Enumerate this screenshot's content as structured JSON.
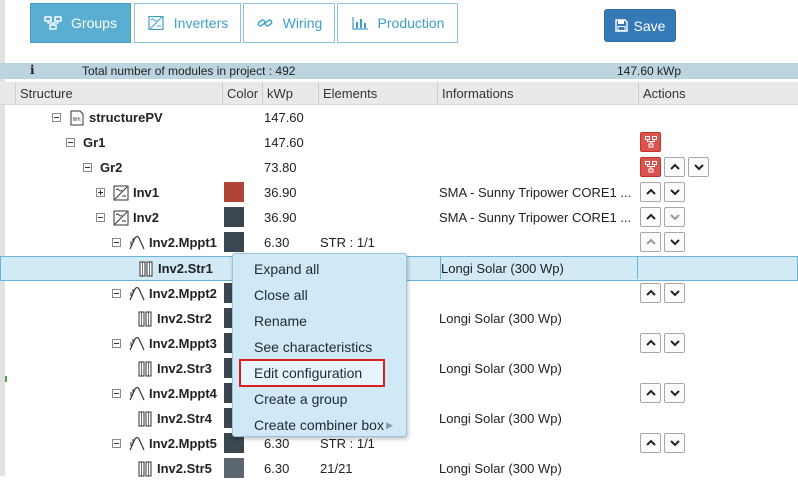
{
  "toolbar": {
    "tabs": [
      {
        "label": "Groups",
        "icon": "groups-icon",
        "active": true
      },
      {
        "label": "Inverters",
        "icon": "inverter-icon",
        "active": false
      },
      {
        "label": "Wiring",
        "icon": "link-icon",
        "active": false
      },
      {
        "label": "Production",
        "icon": "bar-chart-icon",
        "active": false
      }
    ],
    "save_label": "Save"
  },
  "infobar": {
    "icon": "info-icon",
    "icon_glyph": "i",
    "message": "Total number of modules in project : 492",
    "total": "147.60 kWp"
  },
  "columns": [
    "Structure",
    "Color",
    "kWp",
    "Elements",
    "Informations",
    "Actions"
  ],
  "colors": {
    "accent": "#5aaed1",
    "save": "#337ab7",
    "red_swatch": "#b04437",
    "dark_swatch": "#3b4650",
    "action_red": "#d9534f",
    "selection": "#d2e9f6",
    "highlight_border": "#d9201e"
  },
  "rows": [
    {
      "label": "structurePV",
      "kwp": "147.60",
      "elements": "",
      "info": ""
    },
    {
      "label": "Gr1",
      "kwp": "147.60",
      "elements": "",
      "info": ""
    },
    {
      "label": "Gr2",
      "kwp": "73.80",
      "elements": "",
      "info": ""
    },
    {
      "label": "Inv1",
      "kwp": "36.90",
      "elements": "",
      "info": "SMA - Sunny Tripower CORE1 ..."
    },
    {
      "label": "Inv2",
      "kwp": "36.90",
      "elements": "",
      "info": "SMA - Sunny Tripower CORE1 ..."
    },
    {
      "label": "Inv2.Mppt1",
      "kwp": "6.30",
      "elements": "STR : 1/1",
      "info": ""
    },
    {
      "label": "Inv2.Str1",
      "kwp": "",
      "elements": "",
      "info": "Longi Solar (300 Wp)"
    },
    {
      "label": "Inv2.Mppt2",
      "kwp": "",
      "elements": "",
      "info": ""
    },
    {
      "label": "Inv2.Str2",
      "kwp": "",
      "elements": "",
      "info": "Longi Solar (300 Wp)"
    },
    {
      "label": "Inv2.Mppt3",
      "kwp": "",
      "elements": "",
      "info": ""
    },
    {
      "label": "Inv2.Str3",
      "kwp": "",
      "elements": "",
      "info": "Longi Solar (300 Wp)"
    },
    {
      "label": "Inv2.Mppt4",
      "kwp": "",
      "elements": "",
      "info": ""
    },
    {
      "label": "Inv2.Str4",
      "kwp": "",
      "elements": "",
      "info": "Longi Solar (300 Wp)"
    },
    {
      "label": "Inv2.Mppt5",
      "kwp": "6.30",
      "elements": "STR : 1/1",
      "info": ""
    },
    {
      "label": "Inv2.Str5",
      "kwp": "6.30",
      "elements": "21/21",
      "info": "Longi Solar (300 Wp)"
    }
  ],
  "context_menu": {
    "items": [
      {
        "label": "Expand all"
      },
      {
        "label": "Close all"
      },
      {
        "label": "Rename"
      },
      {
        "label": "See characteristics"
      },
      {
        "label": "Edit configuration",
        "highlighted": true
      },
      {
        "label": "Create a group"
      },
      {
        "label": "Create combiner box",
        "submenu": true
      }
    ],
    "submenu_arrow": "▶"
  }
}
